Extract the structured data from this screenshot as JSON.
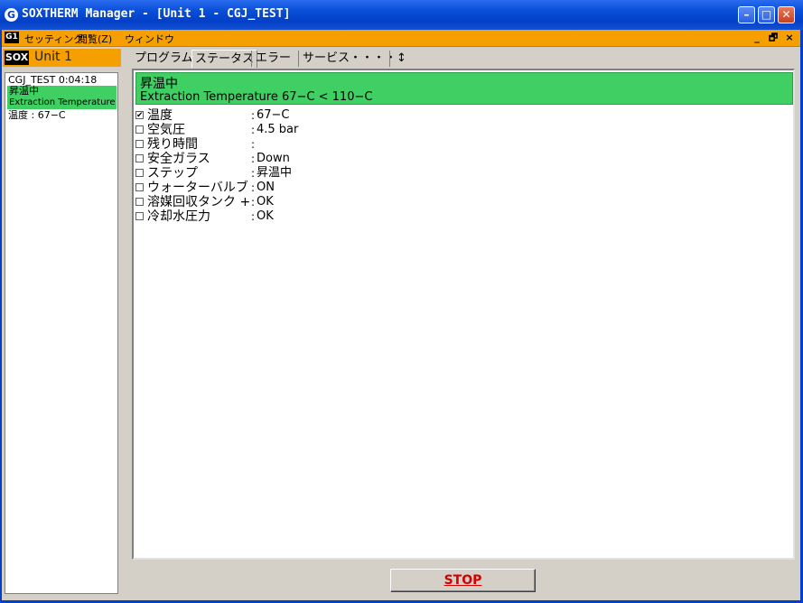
{
  "window": {
    "title": "SOXTHERM Manager - [Unit 1  - CGJ_TEST]",
    "app_icon": "G",
    "minimize": "–",
    "maximize": "□",
    "close": "✕"
  },
  "menubar": {
    "icon_text": "G1",
    "items": [
      "セッティング",
      "閲覧(Z)",
      "ウィンドウ"
    ],
    "mdi_min": "_",
    "mdi_restore": "🗗",
    "mdi_close": "×"
  },
  "left": {
    "badge": "SOX",
    "unit_title": "Unit 1",
    "list_line1": "CGJ_TEST  0:04:18",
    "list_status": "昇温中",
    "list_detail": "Extraction Temperature",
    "list_temp": "温度    : 67−C"
  },
  "tabs": [
    "プログラム",
    "ステータス",
    "エラー",
    "サービス・・・・↕"
  ],
  "active_tab": 1,
  "status_banner": {
    "title": "昇温中",
    "detail": "Extraction Temperature 67−C < 110−C"
  },
  "rows": [
    {
      "label": "温度",
      "value": "67−C",
      "checked": true
    },
    {
      "label": "空気圧",
      "value": "4.5 bar",
      "checked": false
    },
    {
      "label": "残り時間",
      "value": "",
      "checked": false
    },
    {
      "label": "安全ガラス",
      "value": "Down",
      "checked": false
    },
    {
      "label": "ステップ",
      "value": "昇温中",
      "checked": false
    },
    {
      "label": "ウォーターバルブ",
      "value": "ON",
      "checked": false
    },
    {
      "label": "溶媒回収タンク +",
      "value": "OK",
      "checked": false
    },
    {
      "label": "冷却水圧力",
      "value": "OK",
      "checked": false
    }
  ],
  "row_separator": ":",
  "stop_label": "STOP",
  "colors": {
    "titlebar": "#0340c8",
    "menubar": "#f5a000",
    "status_green": "#3fcf63",
    "stop_text": "#d40000"
  }
}
